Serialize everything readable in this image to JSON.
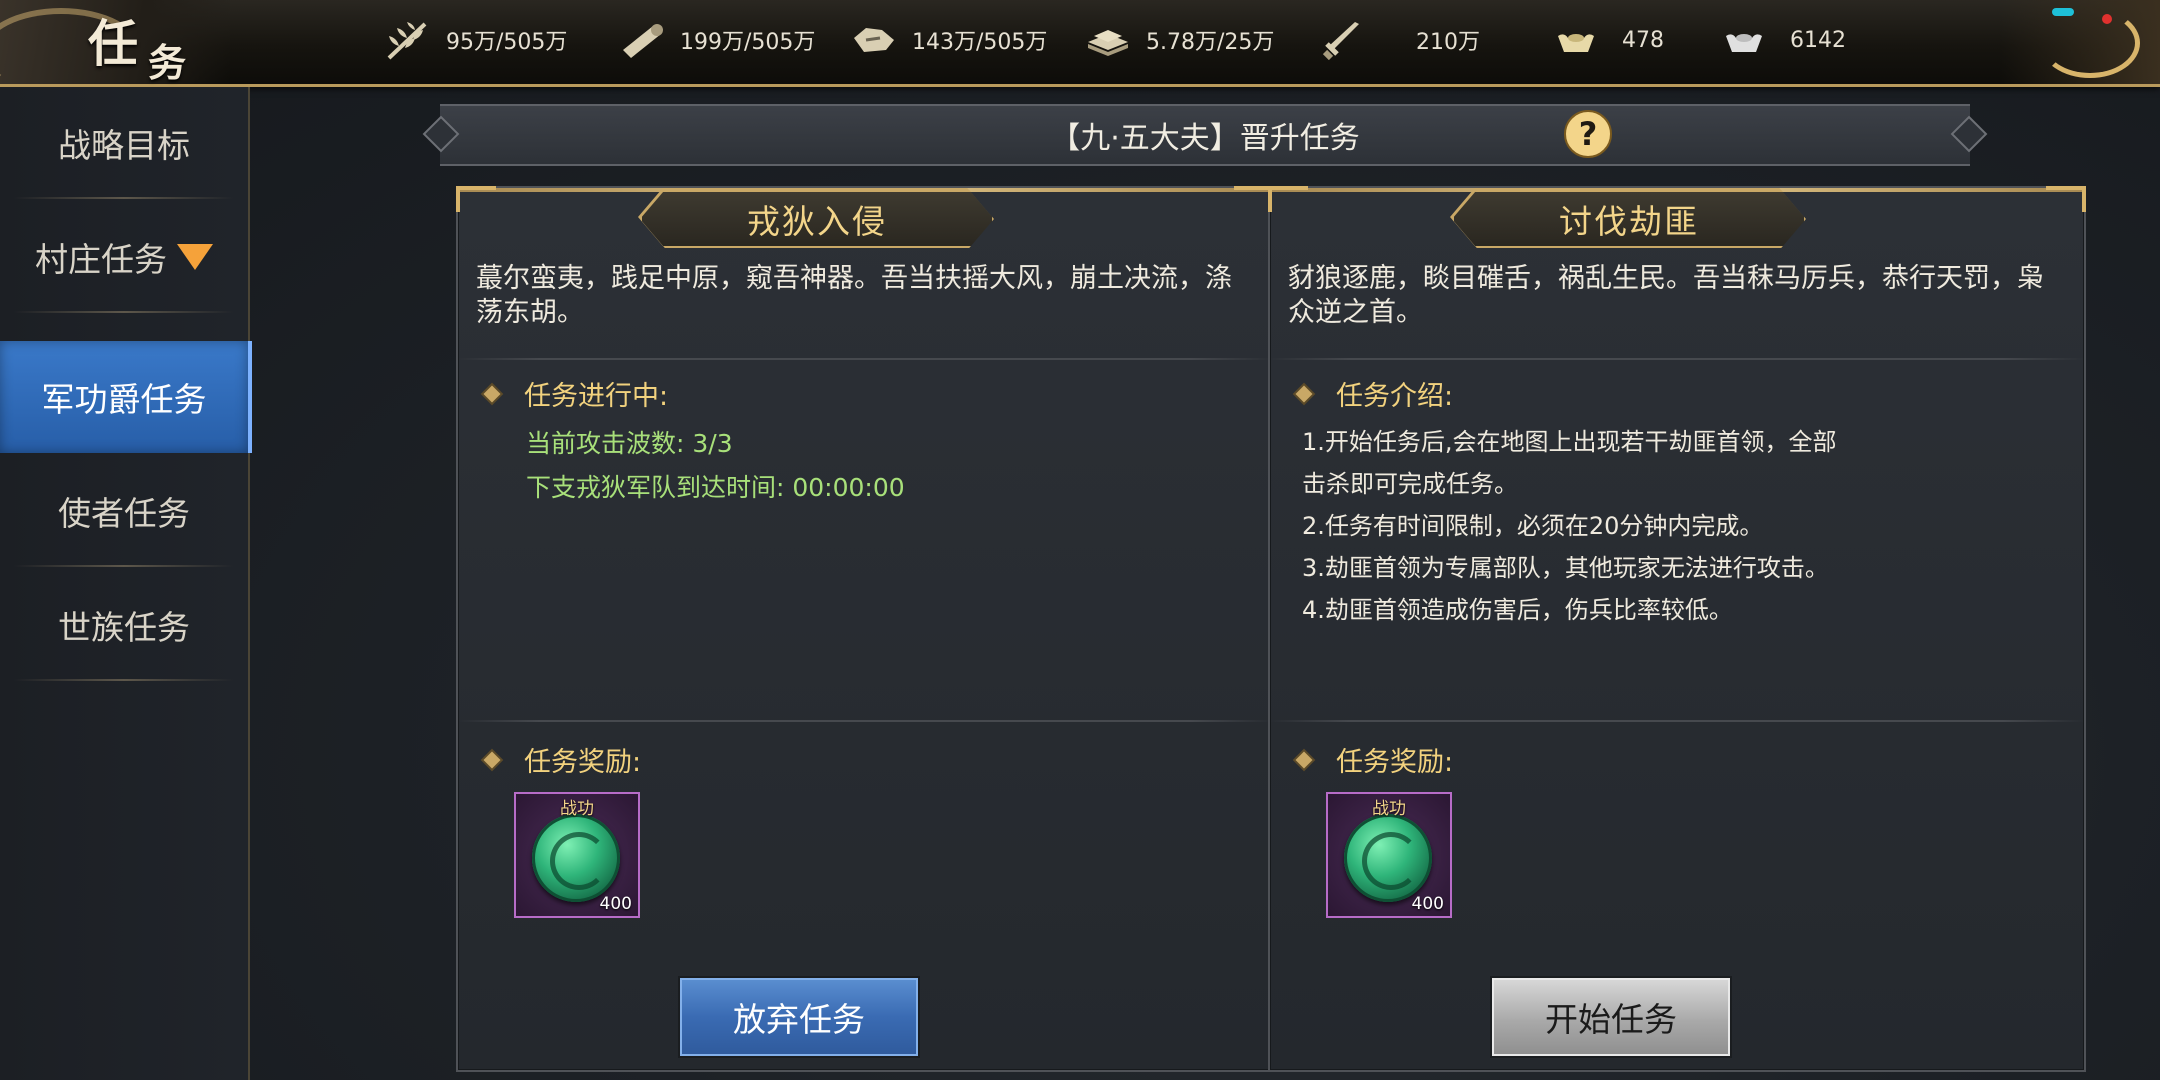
{
  "window": {
    "title_char1": "任",
    "title_char2": "务"
  },
  "resources": [
    {
      "icon": "grain-icon",
      "value": "95万/505万"
    },
    {
      "icon": "wood-icon",
      "value": "199万/505万"
    },
    {
      "icon": "stone-icon",
      "value": "143万/505万"
    },
    {
      "icon": "iron-icon",
      "value": "5.78万/25万"
    },
    {
      "icon": "sword-icon",
      "value": "210万"
    },
    {
      "icon": "gold-ingot-icon",
      "value": "478"
    },
    {
      "icon": "silver-ingot-icon",
      "value": "6142"
    }
  ],
  "sidebar": {
    "items": [
      {
        "label": "战略目标"
      },
      {
        "label": "村庄任务"
      },
      {
        "label": "军功爵任务"
      },
      {
        "label": "使者任务"
      },
      {
        "label": "世族任务"
      }
    ],
    "active_index": 2
  },
  "header": {
    "title": "【九·五大夫】晋升任务",
    "help_label": "?"
  },
  "left_panel": {
    "title": "戎狄入侵",
    "description": "蕞尔蛮夷，践足中原，窥吾神器。吾当扶摇大风，崩土决流，涤荡东胡。",
    "progress_heading": "任务进行中:",
    "wave_text": "当前攻击波数:  3/3",
    "arrival_text": "下支戎狄军队到达时间: 00:00:00",
    "reward_heading": "任务奖励:",
    "reward": {
      "label": "战功",
      "count": "400",
      "icon": "merit-medal-icon"
    },
    "button_label": "放弃任务"
  },
  "right_panel": {
    "title": "讨伐劫匪",
    "description": "豺狼逐鹿，睒目磪舌，祸乱生民。吾当秣马厉兵，恭行天罚，枭众逆之首。",
    "intro_heading": "任务介绍:",
    "intro_lines": [
      "1.开始任务后,会在地图上出现若干劫匪首领，全部",
      "击杀即可完成任务。",
      "2.任务有时间限制，必须在20分钟内完成。",
      "3.劫匪首领为专属部队，其他玩家无法进行攻击。",
      "4.劫匪首领造成伤害后，伤兵比率较低。"
    ],
    "reward_heading": "任务奖励:",
    "reward": {
      "label": "战功",
      "count": "400",
      "icon": "merit-medal-icon"
    },
    "button_label": "开始任务"
  },
  "colors": {
    "accent_gold": "#d8b46a",
    "active_blue": "#3a79c9",
    "progress_green": "#a8e07a"
  }
}
